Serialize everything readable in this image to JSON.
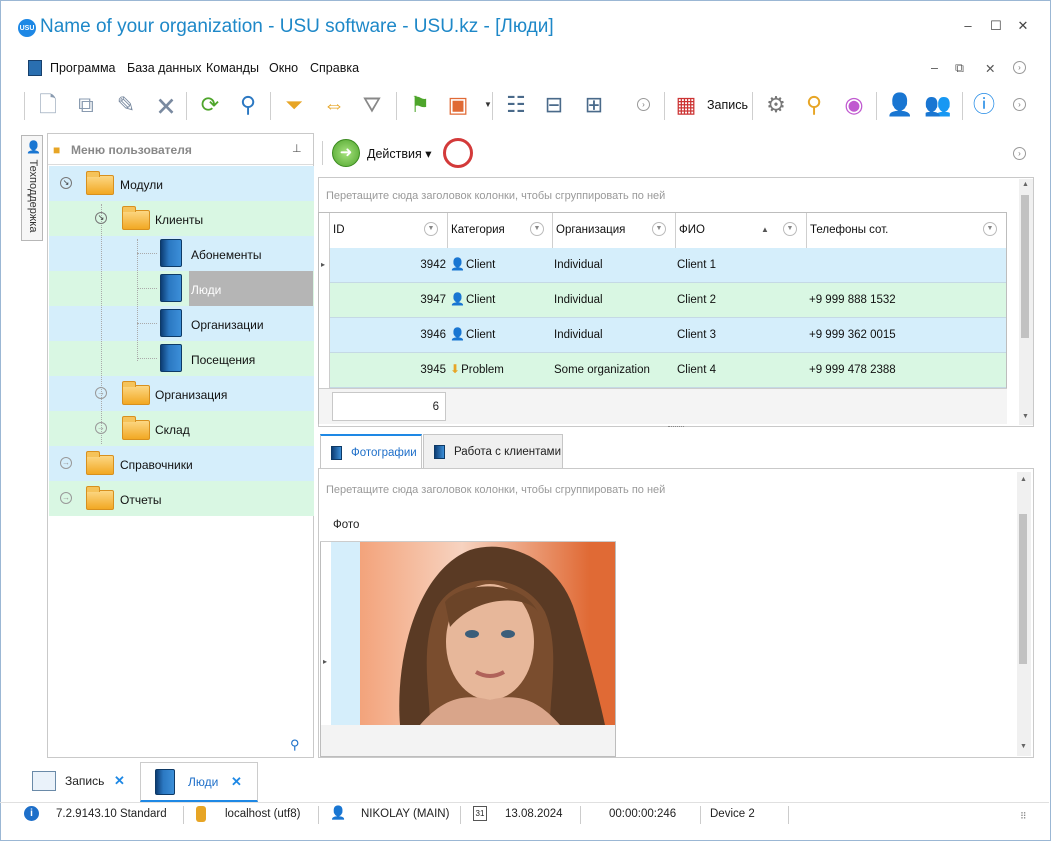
{
  "window": {
    "title": "Name of your organization - USU software - USU.kz - [Люди]",
    "logo_text": "USU",
    "controls": [
      "–",
      "☐",
      "✕"
    ]
  },
  "menu": {
    "items": [
      "Программа",
      "База данных",
      "Команды",
      "Окно",
      "Справка"
    ],
    "mdi_controls": [
      "–",
      "⧉",
      "✕"
    ]
  },
  "toolbar": {
    "record_label": "Запись",
    "icons": [
      "add-document-icon",
      "copy-document-icon",
      "edit-document-icon",
      "delete-document-icon",
      "refresh-icon",
      "search-icon",
      "filter-icon",
      "column-filter-icon",
      "filter-check-icon",
      "flag-icon",
      "image-icon",
      "tree-expand-icon",
      "tree-collapse-icon",
      "tree-hierarchy-icon",
      "calendar-icon",
      "gear-icon",
      "map-pin-icon",
      "color-wheel-icon",
      "user-icon",
      "users-icon",
      "info-icon"
    ]
  },
  "sidetab": {
    "label": "Техподдержка"
  },
  "left_panel": {
    "title": "Меню пользователя",
    "tree": [
      {
        "label": "Модули",
        "level": 0
      },
      {
        "label": "Клиенты",
        "level": 1
      },
      {
        "label": "Абонементы",
        "level": 2
      },
      {
        "label": "Люди",
        "level": 2,
        "selected": true
      },
      {
        "label": "Организации",
        "level": 2
      },
      {
        "label": "Посещения",
        "level": 2
      },
      {
        "label": "Организация",
        "level": 1
      },
      {
        "label": "Склад",
        "level": 1
      },
      {
        "label": "Справочники",
        "level": 0
      },
      {
        "label": "Отчеты",
        "level": 0
      }
    ]
  },
  "actions": {
    "label": "Действия"
  },
  "grid_main": {
    "group_hint": "Перетащите сюда заголовок колонки, чтобы сгруппировать по ней",
    "columns": [
      "ID",
      "Категория",
      "Организация",
      "ФИО",
      "Телефоны сот."
    ],
    "sort_column": "ФИО",
    "rows": [
      {
        "id": "3942",
        "category": "Client",
        "organization": "Individual",
        "name": "Client 1",
        "phone": ""
      },
      {
        "id": "3947",
        "category": "Client",
        "organization": "Individual",
        "name": "Client 2",
        "phone": "+9 999 888 1532"
      },
      {
        "id": "3946",
        "category": "Client",
        "organization": "Individual",
        "name": "Client 3",
        "phone": "+9 999 362 0015"
      },
      {
        "id": "3945",
        "category": "Problem",
        "organization": "Some organization",
        "name": "Client 4",
        "phone": "+9 999 478 2388"
      }
    ],
    "footer_count": "6"
  },
  "detail_tabs": [
    "Фотографии",
    "Работа с клиентами"
  ],
  "grid_photo": {
    "group_hint": "Перетащите сюда заголовок колонки, чтобы сгруппировать по ней",
    "column": "Фото"
  },
  "bottom_tabs": [
    {
      "label": "Запись",
      "close": "✕"
    },
    {
      "label": "Люди",
      "close": "✕"
    }
  ],
  "status": {
    "version": "7.2.9143.10 Standard",
    "server": "localhost (utf8)",
    "user": "NIKOLAY (MAIN)",
    "date": "13.08.2024",
    "elapsed": "00:00:00:246",
    "device": "Device 2"
  },
  "colors": {
    "title": "#1e88c8",
    "row_blue": "#d5eefb",
    "row_green": "#d9f7e3",
    "selection": "#b5b5b5",
    "accent": "#1e88e5"
  }
}
